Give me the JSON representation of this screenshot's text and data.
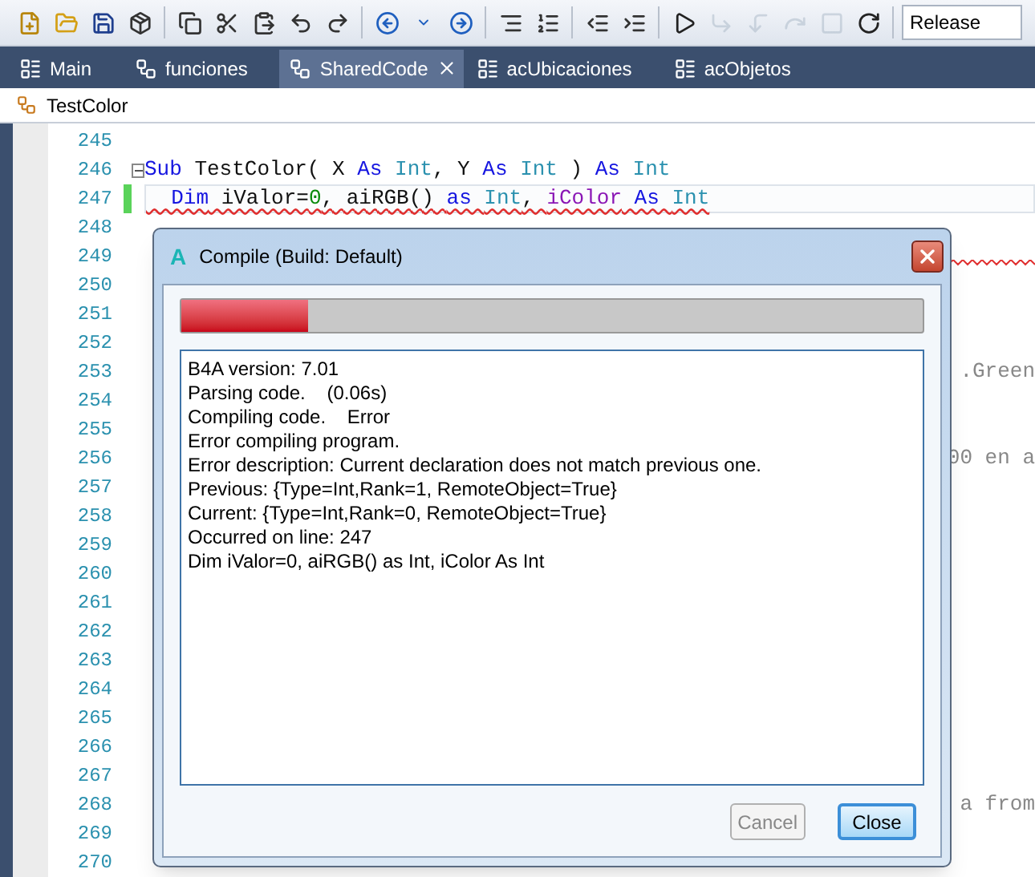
{
  "toolbar": {
    "buttons": [
      {
        "disabled": false
      },
      {
        "disabled": false
      },
      {
        "disabled": false
      },
      {
        "disabled": false
      },
      {
        "disabled": false
      },
      {
        "disabled": false
      },
      {
        "disabled": false
      },
      {
        "disabled": false
      },
      {
        "disabled": false
      },
      {
        "disabled": false
      },
      {
        "disabled": false
      },
      {
        "disabled": false
      },
      {
        "disabled": false
      },
      {
        "disabled": false
      },
      {
        "disabled": false
      },
      {
        "disabled": false
      },
      {
        "disabled": false
      },
      {
        "disabled": true
      },
      {
        "disabled": true
      },
      {
        "disabled": true
      },
      {
        "disabled": true
      },
      {
        "disabled": false
      }
    ],
    "build_config": "Release"
  },
  "tabs": [
    {
      "label": "Main",
      "kind": "module",
      "selected": false,
      "closable": false
    },
    {
      "label": "funciones",
      "kind": "class",
      "selected": false,
      "closable": false
    },
    {
      "label": "SharedCode",
      "kind": "class",
      "selected": true,
      "closable": true
    },
    {
      "label": "acUbicaciones",
      "kind": "module",
      "selected": false,
      "closable": false
    },
    {
      "label": "acObjetos",
      "kind": "module",
      "selected": false,
      "closable": false
    }
  ],
  "breadcrumb": "TestColor",
  "editor": {
    "lines": [
      {
        "number": "245",
        "current": false,
        "changed": false,
        "error": false,
        "fold": false
      },
      {
        "number": "246",
        "current": false,
        "changed": false,
        "error": false,
        "fold": true,
        "tokens": [
          {
            "text": "Sub",
            "kind": "keyword"
          },
          {
            "text": " TestColor( X ",
            "kind": "plain"
          },
          {
            "text": "As ",
            "kind": "keyword"
          },
          {
            "text": "Int",
            "kind": "type"
          },
          {
            "text": ", Y ",
            "kind": "plain"
          },
          {
            "text": "As ",
            "kind": "keyword"
          },
          {
            "text": "Int",
            "kind": "type"
          },
          {
            "text": " ) ",
            "kind": "plain"
          },
          {
            "text": "As ",
            "kind": "keyword"
          },
          {
            "text": "Int",
            "kind": "type"
          }
        ]
      },
      {
        "number": "247",
        "current": true,
        "changed": true,
        "error": true,
        "fold": false,
        "tokens": [
          {
            "text": "  Dim",
            "kind": "keyword"
          },
          {
            "text": " iValor=",
            "kind": "plain"
          },
          {
            "text": "0",
            "kind": "number"
          },
          {
            "text": ", aiRGB() ",
            "kind": "plain"
          },
          {
            "text": "as ",
            "kind": "keyword"
          },
          {
            "text": "Int",
            "kind": "type"
          },
          {
            "text": ", ",
            "kind": "plain"
          },
          {
            "text": "iColor",
            "kind": "global"
          },
          {
            "text": " As ",
            "kind": "keyword"
          },
          {
            "text": "Int",
            "kind": "type"
          }
        ]
      },
      {
        "number": "248",
        "current": false,
        "changed": false,
        "error": false,
        "fold": false
      },
      {
        "number": "249",
        "current": false,
        "changed": false,
        "error": true,
        "fold": false
      },
      {
        "number": "250",
        "current": false,
        "changed": false,
        "error": false,
        "fold": false
      },
      {
        "number": "251",
        "current": false,
        "changed": false,
        "error": false,
        "fold": false
      },
      {
        "number": "252",
        "current": false,
        "changed": false,
        "error": false,
        "fold": false
      },
      {
        "number": "253",
        "current": false,
        "changed": false,
        "error": false,
        "fold": false,
        "tail": ".Green"
      },
      {
        "number": "254",
        "current": false,
        "changed": false,
        "error": false,
        "fold": false
      },
      {
        "number": "255",
        "current": false,
        "changed": false,
        "error": false,
        "fold": false
      },
      {
        "number": "256",
        "current": false,
        "changed": false,
        "error": false,
        "fold": false,
        "tail": "00 en a"
      },
      {
        "number": "257",
        "current": false,
        "changed": false,
        "error": false,
        "fold": false
      },
      {
        "number": "258",
        "current": false,
        "changed": false,
        "error": false,
        "fold": false
      },
      {
        "number": "259",
        "current": false,
        "changed": false,
        "error": false,
        "fold": false
      },
      {
        "number": "260",
        "current": false,
        "changed": false,
        "error": false,
        "fold": false
      },
      {
        "number": "261",
        "current": false,
        "changed": false,
        "error": false,
        "fold": false
      },
      {
        "number": "262",
        "current": false,
        "changed": false,
        "error": false,
        "fold": false
      },
      {
        "number": "263",
        "current": false,
        "changed": false,
        "error": false,
        "fold": false
      },
      {
        "number": "264",
        "current": false,
        "changed": false,
        "error": false,
        "fold": false
      },
      {
        "number": "265",
        "current": false,
        "changed": false,
        "error": false,
        "fold": false
      },
      {
        "number": "266",
        "current": false,
        "changed": false,
        "error": false,
        "fold": false
      },
      {
        "number": "267",
        "current": false,
        "changed": false,
        "error": false,
        "fold": false
      },
      {
        "number": "268",
        "current": false,
        "changed": false,
        "error": false,
        "fold": false,
        "tail": "a from"
      },
      {
        "number": "269",
        "current": false,
        "changed": false,
        "error": false,
        "fold": false
      },
      {
        "number": "270",
        "current": false,
        "changed": false,
        "error": false,
        "fold": false
      }
    ]
  },
  "dialog": {
    "logo": "A",
    "title": "Compile (Build: Default)",
    "progress": {
      "level": 0.17
    },
    "log": [
      "B4A version: 7.01",
      "Parsing code.    (0.06s)",
      "Compiling code.    Error",
      "Error compiling program.",
      "Error description: Current declaration does not match previous one.",
      "Previous: {Type=Int,Rank=1, RemoteObject=True}",
      "Current: {Type=Int,Rank=0, RemoteObject=True}",
      "Occurred on line: 247",
      "Dim iValor=0, aiRGB() as Int, iColor As Int"
    ],
    "buttons": [
      {
        "label": "Cancel",
        "disabled": true,
        "default": false
      },
      {
        "label": "Close",
        "disabled": false,
        "default": true
      }
    ]
  }
}
